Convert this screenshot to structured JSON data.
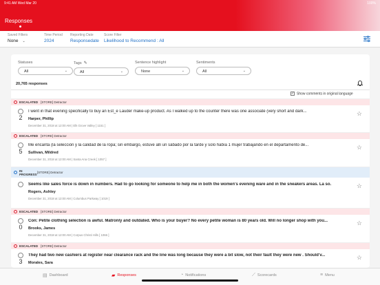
{
  "status_bar": {
    "time_date": "9:41 AM   Wed Mar 20",
    "battery": "100%"
  },
  "header": {
    "title": "Responses"
  },
  "filters": {
    "saved": {
      "label": "Saved Filters",
      "value": "None"
    },
    "period": {
      "label": "Time Period",
      "value": "2024"
    },
    "date": {
      "label": "Reporting Date",
      "value": "Responsedate"
    },
    "score": {
      "label": "Score Filter",
      "value": "Likelihood to Recommend : All"
    }
  },
  "dropdowns": {
    "statuses": {
      "label": "Statuses",
      "value": "All"
    },
    "tags": {
      "label": "Tags",
      "value": "All"
    },
    "highlight": {
      "label": "Sentence highlight",
      "value": "None"
    },
    "sentiments": {
      "label": "Sentiments",
      "value": "All"
    }
  },
  "count": "20,765 responses",
  "show_original": "Show comments in original language",
  "responses": [
    {
      "status": "ESCALATED",
      "tag": "[STORE] Detractor",
      "score": "2",
      "comment": "I went in that evening specifically to buy an Est_e Lauder make-up product. As I walked up to the counter there was one associate (very short and dark...",
      "name": "Harper, Phillip",
      "meta": "December 31, 2018 at 12:00 AM  |  Elk Grove Valley [ 1151 ]"
    },
    {
      "status": "ESCALATED",
      "tag": "[STORE] Detractor",
      "score": "5",
      "comment": "Me encanta (la selección y la calidad de la ropa; sin embargo, estuve allí un sábado por la tarde y solo había 1 mujer trabajando en el departamento de...",
      "name": "Sullivan, Mildred",
      "meta": "December 31, 2018 at 12:00 AM  |  Santa Ana Creek [ 1057 ]"
    },
    {
      "status": "IN PROGRESS",
      "tag": "[STORE] Detractor",
      "score": "",
      "comment": "Seems like sales force is down in numbers. Had to go looking for someone to help me in both the women's evening ware and in the sneakers areas. La so...",
      "name": "Rogers, Ashley",
      "meta": "December 31, 2018 at 12:00 AM  |  Columbus Parkway [ 1019 ]"
    },
    {
      "status": "ESCALATED",
      "tag": "[STORE] Detractor",
      "score": "0",
      "comment": "Con: Petite clothing selection is awful. Matronly and outdated. Who is your buyer? No every petite woman is 80 years old. Will no longer shop with you...",
      "name": "Brooks, James",
      "meta": "December 31, 2018 at 12:00 AM  |  Corpus Christi Hills [ 1066 ]"
    },
    {
      "status": "ESCALATED",
      "tag": "[STORE] Detractor",
      "score": "3",
      "comment": "They had two new cashiers at register near clearance rack and the line was long because they were a bit slow, not their fault they were new . Should'v...",
      "name": "Morales, Sara",
      "meta": ""
    }
  ],
  "tabs": {
    "dashboard": "Dashboard",
    "responses": "Responses",
    "notifications": "Notifications",
    "scorecards": "Scorecards",
    "menu": "Menu"
  },
  "colors": {
    "brand": "#e5101e",
    "link": "#1f6fc5",
    "escalated_bg": "#fde5e7",
    "in_progress_bg": "#e1edf9"
  }
}
